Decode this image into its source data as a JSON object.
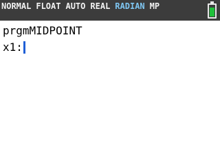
{
  "status_bar": {
    "modes": [
      "NORMAL",
      "FLOAT",
      "AUTO",
      "REAL"
    ],
    "angle_mode": "RADIAN",
    "extra_mode": "MP",
    "battery_level": 0.7,
    "accent_color": "#7fc6f2",
    "battery_color": "#1fbf3a"
  },
  "home_screen": {
    "program_line": "prgmMIDPOINT",
    "prompt": "x1:"
  },
  "cursor_color": "#1f5fd6"
}
